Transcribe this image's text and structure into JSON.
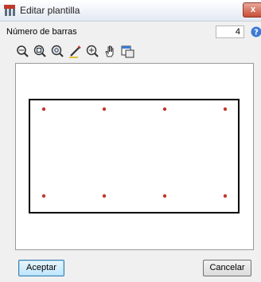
{
  "window": {
    "title": "Editar plantilla",
    "close_glyph": "x"
  },
  "form": {
    "bar_count_label": "Número de barras",
    "bar_count_value": "4"
  },
  "toolbar": {
    "tools": [
      {
        "icon": "zoom-extents-icon"
      },
      {
        "icon": "zoom-window-icon"
      },
      {
        "icon": "zoom-out-icon"
      },
      {
        "icon": "pencil-edit-icon"
      },
      {
        "icon": "zoom-in-icon"
      },
      {
        "icon": "pan-hand-icon"
      },
      {
        "icon": "copy-window-icon"
      }
    ]
  },
  "canvas": {
    "rebar_color": "#c0392b",
    "frame_color": "#000000",
    "top_row_bars": 4,
    "bottom_row_bars": 4
  },
  "buttons": {
    "accept_label": "Aceptar",
    "cancel_label": "Cancelar"
  }
}
